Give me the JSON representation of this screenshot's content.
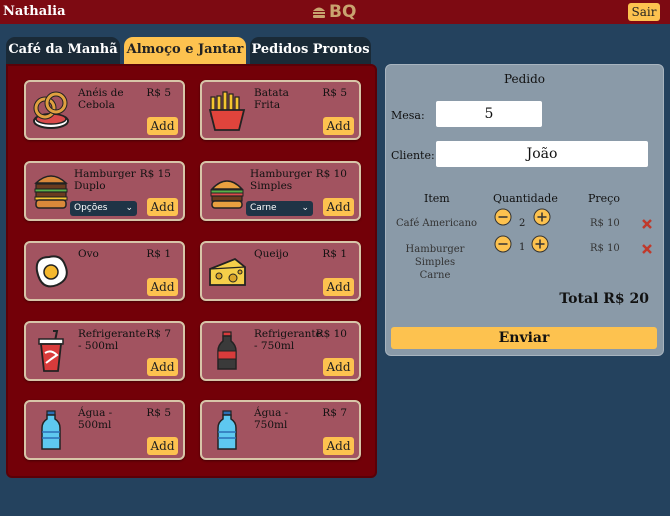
{
  "header": {
    "user": "Nathalia",
    "logo_text": "BQ",
    "logout_label": "Sair"
  },
  "tabs": [
    {
      "label": "Café da Manhã"
    },
    {
      "label": "Almoço e Jantar"
    },
    {
      "label": "Pedidos Prontos"
    }
  ],
  "menu": {
    "items": [
      {
        "name": "Anéis de Cebola",
        "price": "R$ 5",
        "add_label": "Add",
        "icon": "onion-rings-icon"
      },
      {
        "name": "Batata Frita",
        "price": "R$ 5",
        "add_label": "Add",
        "icon": "french-fries-icon"
      },
      {
        "name": "Hamburger Duplo",
        "price": "R$ 15",
        "add_label": "Add",
        "icon": "double-burger-icon",
        "select": "Opções"
      },
      {
        "name": "Hamburger Simples",
        "price": "R$ 10",
        "add_label": "Add",
        "icon": "burger-icon",
        "select": "Carne"
      },
      {
        "name": "Ovo",
        "price": "R$ 1",
        "add_label": "Add",
        "icon": "fried-egg-icon"
      },
      {
        "name": "Queijo",
        "price": "R$ 1",
        "add_label": "Add",
        "icon": "cheese-icon"
      },
      {
        "name": "Refrigerante - 500ml",
        "price": "R$ 7",
        "add_label": "Add",
        "icon": "soda-cup-icon"
      },
      {
        "name": "Refrigerante - 750ml",
        "price": "R$ 10",
        "add_label": "Add",
        "icon": "soda-bottle-icon"
      },
      {
        "name": "Água - 500ml",
        "price": "R$ 5",
        "add_label": "Add",
        "icon": "water-bottle-icon"
      },
      {
        "name": "Água - 750ml",
        "price": "R$ 7",
        "add_label": "Add",
        "icon": "water-bottle-icon"
      }
    ]
  },
  "order": {
    "title": "Pedido",
    "table_label": "Mesa:",
    "table_value": "5",
    "client_label": "Cliente:",
    "client_value": "João",
    "col_item": "Item",
    "col_qty": "Quantidade",
    "col_price": "Preço",
    "rows": [
      {
        "item": "Café Americano",
        "qty": "2",
        "price": "R$ 10"
      },
      {
        "item": "Hamburger Simples Carne",
        "qty": "1",
        "price": "R$ 10"
      }
    ],
    "total": "Total R$ 20",
    "send_label": "Enviar"
  },
  "colors": {
    "topbar": "#7d0a12",
    "background": "#24425e",
    "accent": "#fdc24f",
    "menu_panel": "#730008",
    "card": "#a25360",
    "order_panel": "#8a9aa8",
    "remove": "#c0392b"
  }
}
